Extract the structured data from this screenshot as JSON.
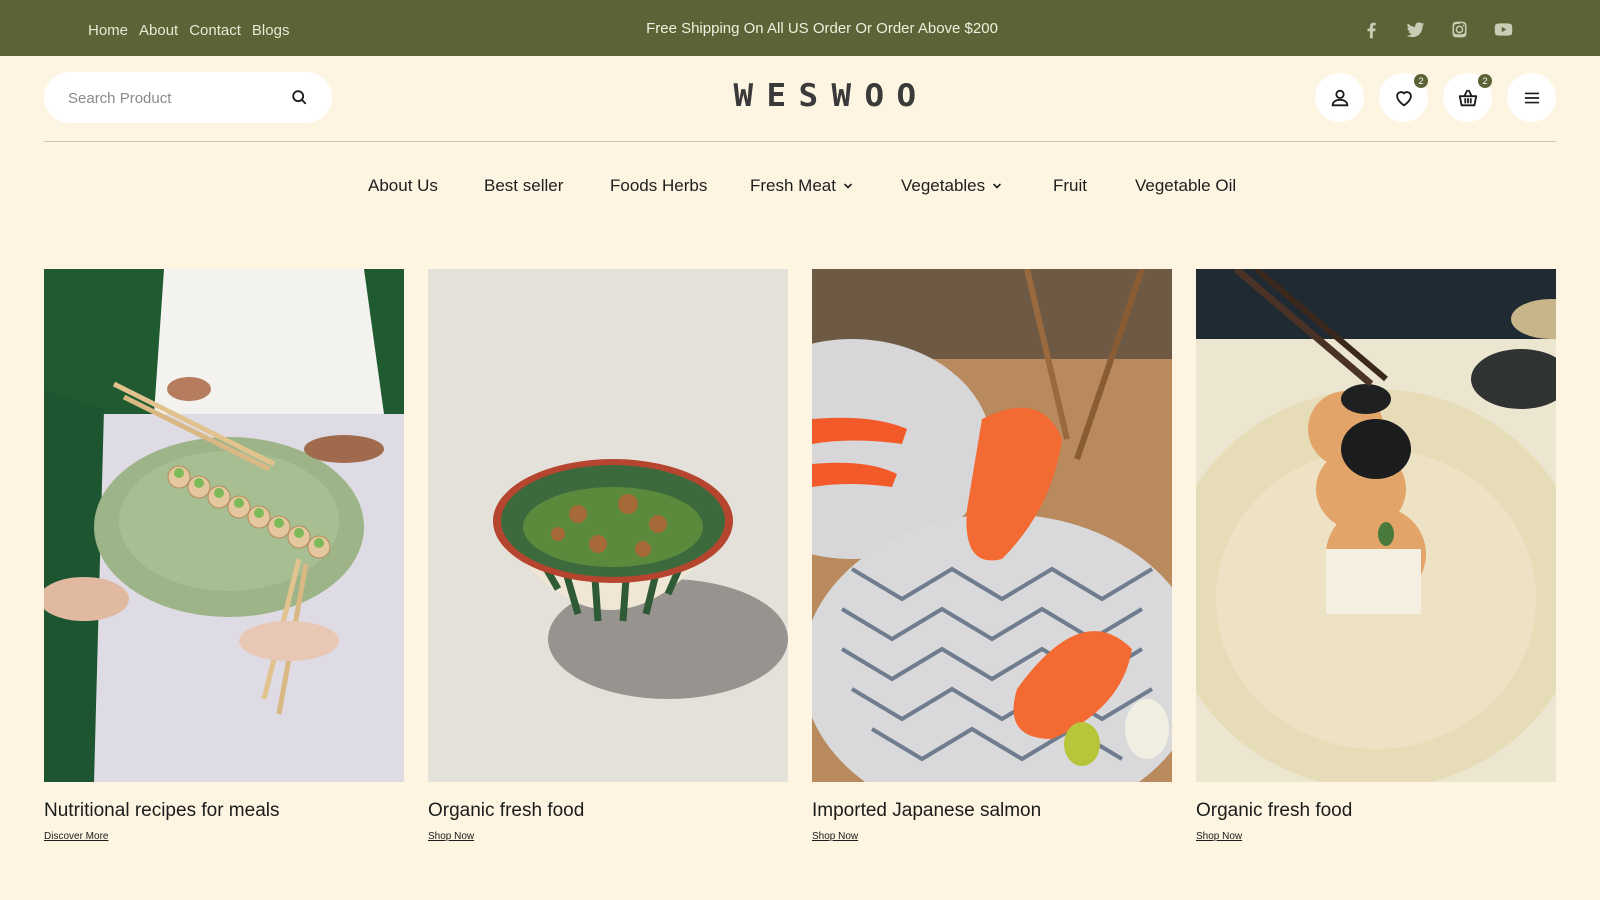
{
  "topbar": {
    "nav": [
      "Home",
      "About",
      "Contact",
      "Blogs"
    ],
    "promo": "Free Shipping On All US Order Or Order Above $200",
    "socials": [
      "facebook-icon",
      "twitter-icon",
      "instagram-icon",
      "youtube-icon"
    ],
    "bg_color": "#5a6437"
  },
  "header": {
    "search_placeholder": "Search Product",
    "logo_letters": [
      "W",
      "E",
      "S",
      "W",
      "O",
      "O"
    ],
    "wishlist_count": "2",
    "cart_count": "2"
  },
  "nav": [
    {
      "label": "About Us",
      "dropdown": false
    },
    {
      "label": "Best seller",
      "dropdown": false
    },
    {
      "label": "Foods Herbs",
      "dropdown": false
    },
    {
      "label": "Fresh Meat",
      "dropdown": true
    },
    {
      "label": "Vegetables",
      "dropdown": true
    },
    {
      "label": "Fruit",
      "dropdown": false
    },
    {
      "label": "Vegetable Oil",
      "dropdown": false
    }
  ],
  "cards": [
    {
      "title": "Nutritional recipes for meals",
      "cta": "Discover More"
    },
    {
      "title": "Organic fresh food",
      "cta": "Shop Now"
    },
    {
      "title": "Imported Japanese salmon",
      "cta": "Shop Now"
    },
    {
      "title": "Organic fresh food",
      "cta": "Shop Now"
    }
  ],
  "colors": {
    "page_bg": "#fdf4e1",
    "accent": "#5a6437"
  }
}
